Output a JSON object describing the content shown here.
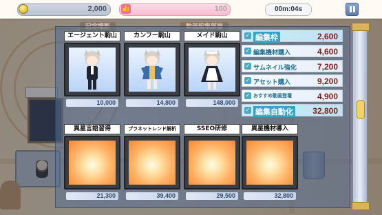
{
  "topbar": {
    "coins": "2,000",
    "likes": "100",
    "timer": "00m:04s"
  },
  "rooms": [
    "記念撮影",
    "動画編集部屋"
  ],
  "upgrades": [
    {
      "label": "編集枠",
      "value": "2,600",
      "highlight": true
    },
    {
      "label": "編集機材購入",
      "value": "4,600",
      "highlight": false
    },
    {
      "label": "サムネイル強化",
      "value": "7,200",
      "highlight": false
    },
    {
      "label": "アセット購入",
      "value": "9,200",
      "highlight": false
    },
    {
      "label": "おすすめ動画登壇",
      "value": "4,900",
      "highlight": false
    },
    {
      "label": "編集自動化",
      "value": "32,800",
      "highlight": true
    }
  ],
  "characters": [
    {
      "title": "エージェント駒山",
      "price": "10,000"
    },
    {
      "title": "カンフー駒山",
      "price": "14,800"
    },
    {
      "title": "メイド駒山",
      "price": "148,000"
    }
  ],
  "skills": [
    {
      "title": "異星言語習得",
      "price": "21,300"
    },
    {
      "title": "プラネットレンド解析",
      "price": "39,400"
    },
    {
      "title": "SSEO研修",
      "price": "29,500"
    },
    {
      "title": "異星機材導入",
      "price": "32,800"
    }
  ],
  "colors": {
    "accent": "#3aa3c8",
    "price_text": "#7a1f1a",
    "coin": "#e7b92a",
    "like": "#f06f9a"
  }
}
